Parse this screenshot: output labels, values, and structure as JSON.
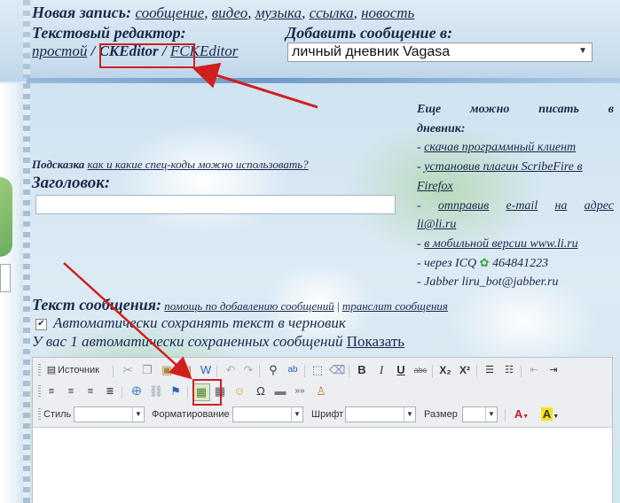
{
  "header": {
    "new_entry_label": "Новая запись:",
    "entry_types": [
      "сообщение",
      "видео",
      "музыка",
      "ссылка",
      "новость"
    ],
    "separator": ",",
    "text_editor_label": "Текстовый редактор:",
    "editors": [
      "простой",
      "CKEditor",
      "FCKEditor"
    ],
    "editor_separator": "/",
    "add_to_label": "Добавить сообщение в:",
    "diary_select_value": "личный дневник Vagasa"
  },
  "right_panel": {
    "title_line1_words": [
      "Еще",
      "можно",
      "писать",
      "в"
    ],
    "title_line2": "дневник:",
    "items": [
      {
        "prefix": "- ",
        "link": "скачав программный клиент"
      },
      {
        "prefix": "- ",
        "link": "установив плагин ScribeFire в Firefox"
      },
      {
        "prefix": "- ",
        "link": "отправив e-mail на адрес li@li.ru"
      },
      {
        "prefix": "- ",
        "link": "в мобильной версии www.li.ru"
      },
      {
        "text": "- через ICQ",
        "icq_number": "464841223"
      },
      {
        "text": "- Jabber liru_bot@jabber.ru"
      }
    ],
    "line2_part1": "установив плагин ScribeFire в",
    "line2_part2": "Firefox",
    "line3_part1_words": [
      "отправив",
      "e-mail",
      "на",
      "адрес"
    ],
    "line3_part2": "li@li.ru"
  },
  "hint": {
    "label": "Подсказка",
    "link": "как и какие спец-коды можно использовать?"
  },
  "title_field_label": "Заголовок:",
  "message": {
    "label": "Текст сообщения:",
    "help_link": "помощь по добавлению сообщений",
    "divider": "|",
    "translit_link": "транслит сообщения",
    "autosave_label": "Автоматически сохранять текст в черновик",
    "autosave_checked": "✔",
    "saved_info": "У вас 1 автоматически сохраненных сообщений",
    "show_link": "Показать"
  },
  "toolbar": {
    "source_label": "Источник",
    "style_label": "Стиль",
    "format_label": "Форматирование",
    "font_label": "Шрифт",
    "size_label": "Размер",
    "bold": "B",
    "italic": "I",
    "underline": "U",
    "strike": "abc",
    "subscript": "X₂",
    "superscript": "X²",
    "text_color_glyph": "A",
    "bg_color_glyph": "A",
    "omega": "Ω",
    "more": "»»"
  },
  "colors": {
    "annotation_red": "#d0201d",
    "text_main": "#1a2a4a",
    "highlight_yellow": "#f2e31a"
  }
}
